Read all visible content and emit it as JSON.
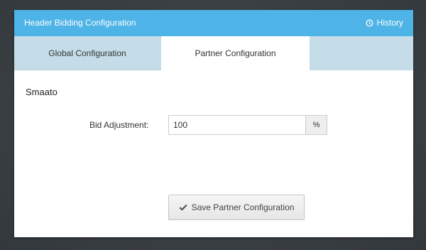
{
  "panel": {
    "title": "Header Bidding Configuration",
    "history_label": "History",
    "history_icon": "clock-icon"
  },
  "tabs": [
    {
      "label": "Global Configuration",
      "active": false
    },
    {
      "label": "Partner Configuration",
      "active": true
    }
  ],
  "partner": {
    "name": "Smaato",
    "bid_adjustment": {
      "label": "Bid Adjustment:",
      "value": "100",
      "unit": "%"
    },
    "save_label": "Save Partner Configuration",
    "save_icon": "check-icon"
  },
  "colors": {
    "header": "#4eb3e6",
    "tab_strip": "#c5dde9",
    "backdrop": "#3b4045"
  }
}
